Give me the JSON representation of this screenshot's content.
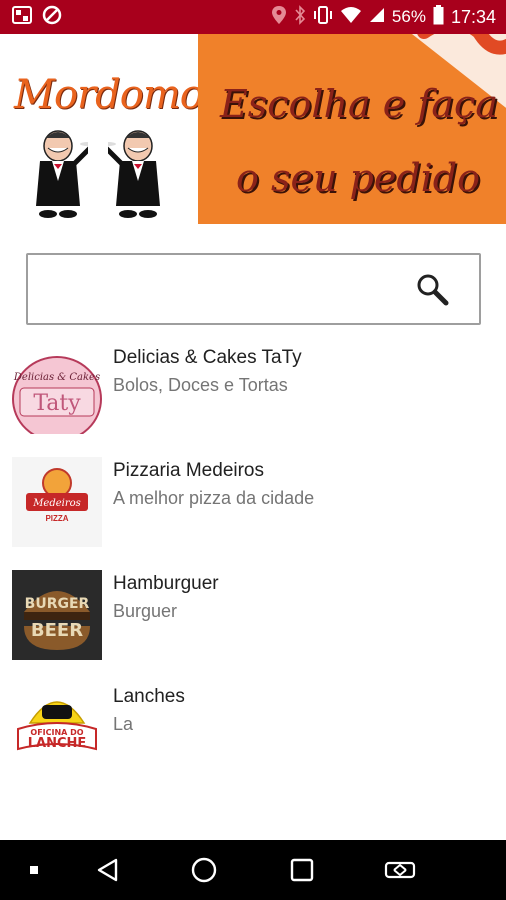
{
  "status_bar": {
    "battery": "56%",
    "time": "17:34",
    "bg_color": "#a8001c"
  },
  "banner": {
    "brand": "Mordomo",
    "slogan_line1": "Escolha e faça",
    "slogan_line2": "o seu pedido",
    "accent_color": "#f0812a"
  },
  "search": {
    "value": "",
    "placeholder": ""
  },
  "restaurants": [
    {
      "name": "Delicias & Cakes TaTy",
      "description": "Bolos, Doces e Tortas",
      "logo": "taty-logo",
      "logo_text_top": "Delicias & Cakes",
      "logo_text_main": "Taty"
    },
    {
      "name": "Pizzaria Medeiros",
      "description": "A melhor pizza da cidade",
      "logo": "pizzaria-logo",
      "logo_text_top": "Medeiros",
      "logo_text_main": "PIZZA"
    },
    {
      "name": "Hamburguer",
      "description": "Burguer",
      "logo": "burger-beer-logo",
      "logo_text_top": "BURGER",
      "logo_text_main": "BEER"
    },
    {
      "name": "Lanches",
      "description": "La",
      "logo": "oficina-lanche-logo",
      "logo_text_top": "OFICINA DO",
      "logo_text_main": "LANCHE"
    }
  ],
  "nav_bar": {
    "icons": [
      "dot-icon",
      "back-icon",
      "home-icon",
      "recents-icon",
      "rotate-icon"
    ]
  }
}
